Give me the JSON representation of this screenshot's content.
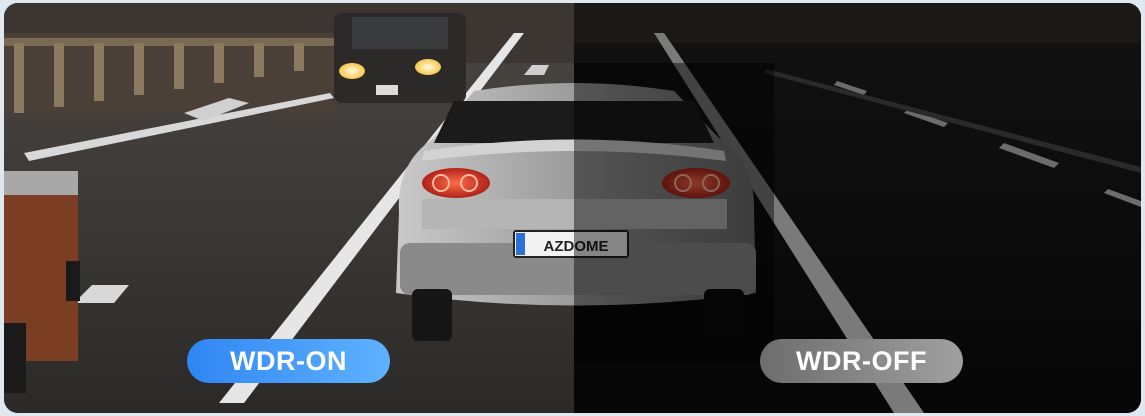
{
  "labels": {
    "wdr_on": "WDR-ON",
    "wdr_off": "WDR-OFF"
  },
  "license_plate": "AZDOME",
  "colors": {
    "on_badge_start": "#2f86f3",
    "on_badge_end": "#5fb2ff",
    "off_badge_start": "#6d6d6d",
    "off_badge_end": "#a0a0a0"
  }
}
